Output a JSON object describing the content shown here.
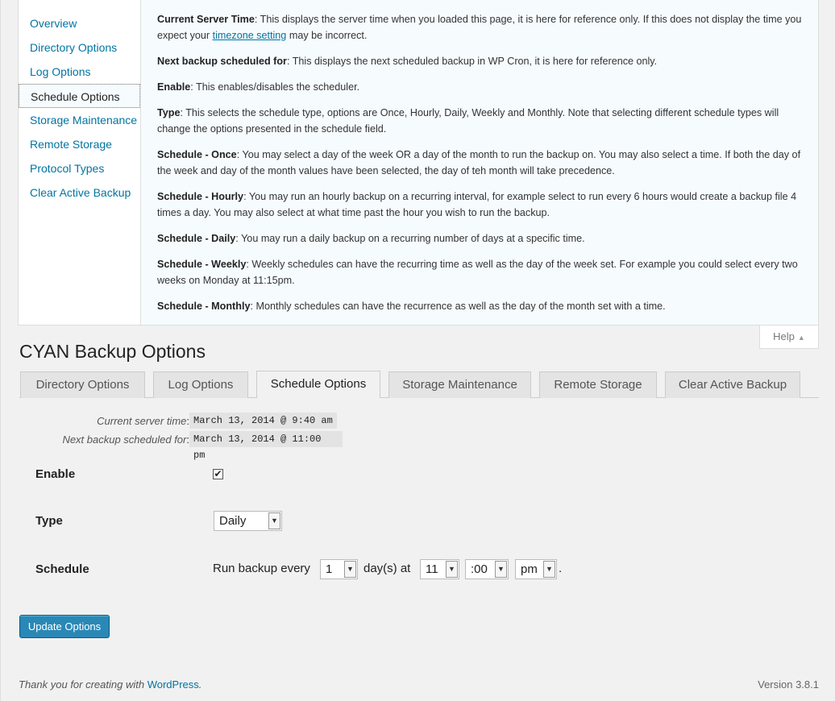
{
  "help": {
    "tabs": [
      {
        "label": "Overview"
      },
      {
        "label": "Directory Options"
      },
      {
        "label": "Log Options"
      },
      {
        "label": "Schedule Options"
      },
      {
        "label": "Storage Maintenance"
      },
      {
        "label": "Remote Storage"
      },
      {
        "label": "Protocol Types"
      },
      {
        "label": "Clear Active Backup"
      }
    ],
    "active_tab": "Schedule Options",
    "paragraphs": [
      {
        "term": "Current Server Time",
        "text_before": ": This displays the server time when you loaded this page, it is here for reference only. If this does not display the time you expect your ",
        "link": "timezone setting",
        "text_after": " may be incorrect."
      },
      {
        "term": "Next backup scheduled for",
        "text": ": This displays the next scheduled backup in WP Cron, it is here for reference only."
      },
      {
        "term": "Enable",
        "text": ": This enables/disables the scheduler."
      },
      {
        "term": "Type",
        "text": ": This selects the schedule type, options are Once, Hourly, Daily, Weekly and Monthly. Note that selecting different schedule types will change the options presented in the schedule field."
      },
      {
        "term": "Schedule - Once",
        "text": ": You may select a day of the week OR a day of the month to run the backup on. You may also select a time. If both the day of the week and day of the month values have been selected, the day of teh month will take precedence."
      },
      {
        "term": "Schedule - Hourly",
        "text": ": You may run an hourly backup on a recurring interval, for example select to run every 6 hours would create a backup file 4 times a day. You may also select at what time past the hour you wish to run the backup."
      },
      {
        "term": "Schedule - Daily",
        "text": ": You may run a daily backup on a recurring number of days at a specific time."
      },
      {
        "term": "Schedule - Weekly",
        "text": ": Weekly schedules can have the recurring time as well as the day of the week set. For example you could select every two weeks on Monday at 11:15pm."
      },
      {
        "term": "Schedule - Monthly",
        "text": ": Monthly schedules can have the recurrence as well as the day of the month set with a time."
      }
    ],
    "toggle_label": "Help"
  },
  "page_title": "CYAN Backup Options",
  "tabs": [
    {
      "label": "Directory Options"
    },
    {
      "label": "Log Options"
    },
    {
      "label": "Schedule Options"
    },
    {
      "label": "Storage Maintenance"
    },
    {
      "label": "Remote Storage"
    },
    {
      "label": "Clear Active Backup"
    }
  ],
  "active_tab": "Schedule Options",
  "server_info": {
    "current_label": "Current server time",
    "current_value": "March 13, 2014 @ 9:40 am",
    "next_label": "Next backup scheduled for",
    "next_value": "March 13, 2014 @ 11:00 pm",
    "colon": ":"
  },
  "form": {
    "enable_label": "Enable",
    "enable_checked": true,
    "type_label": "Type",
    "type_value": "Daily",
    "schedule_label": "Schedule",
    "run_every_text": "Run backup every",
    "interval_value": "1",
    "days_at_text": "day(s) at",
    "hour_value": "11",
    "minute_value": ":00",
    "ampm_value": "pm",
    "period": "."
  },
  "update_button": "Update Options",
  "footer": {
    "thanks_text": "Thank you for creating with ",
    "wp_link": "WordPress",
    "thanks_end": ".",
    "version": "Version 3.8.1"
  },
  "colors": {
    "link": "#0074a2",
    "button": "#2a88b6",
    "help_bg": "#f6fbfd"
  }
}
